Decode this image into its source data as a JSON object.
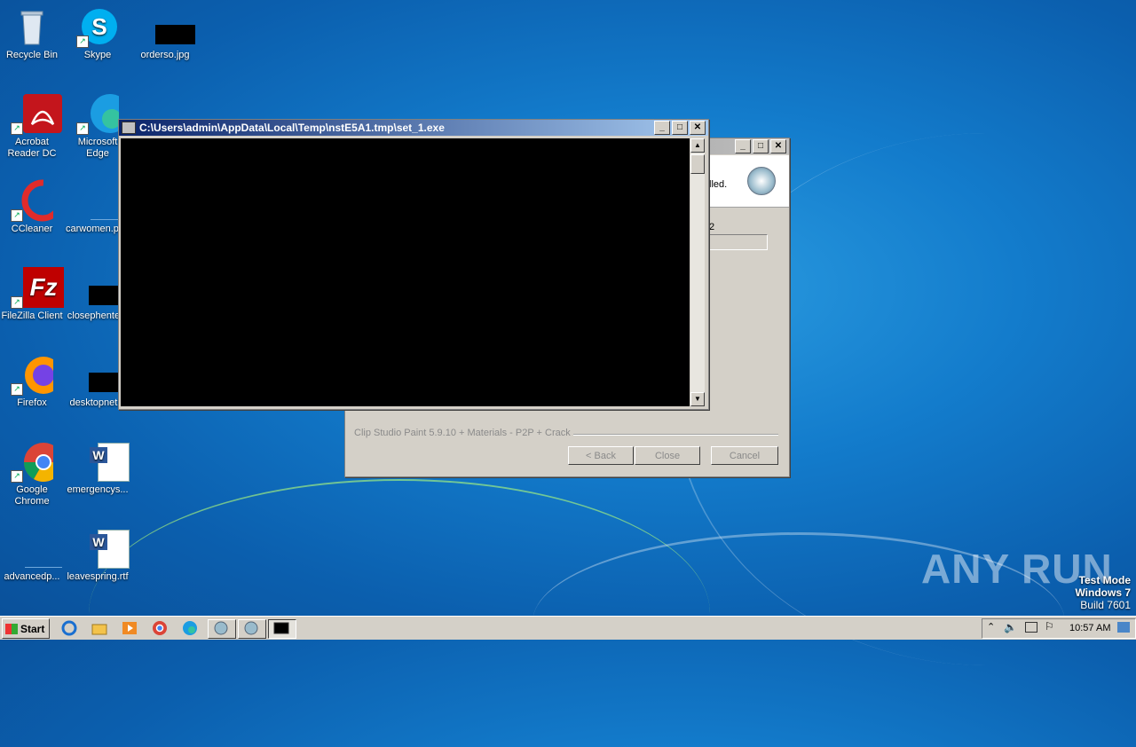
{
  "desktop": {
    "icons": [
      {
        "label": "Recycle Bin",
        "icon": "recycle-bin-icon"
      },
      {
        "label": "Skype",
        "icon": "skype-icon"
      },
      {
        "label": "orderso.jpg",
        "icon": "image-file-icon"
      },
      {
        "label": "Acrobat Reader DC",
        "icon": "acrobat-icon"
      },
      {
        "label": "Microsoft Edge",
        "icon": "edge-icon"
      },
      {
        "label": "CCleaner",
        "icon": "ccleaner-icon"
      },
      {
        "label": "carwomen.png",
        "icon": "file-icon"
      },
      {
        "label": "FileZilla Client",
        "icon": "filezilla-icon"
      },
      {
        "label": "closephente...",
        "icon": "file-icon"
      },
      {
        "label": "Firefox",
        "icon": "firefox-icon"
      },
      {
        "label": "desktopnet...",
        "icon": "file-icon"
      },
      {
        "label": "Google Chrome",
        "icon": "chrome-icon"
      },
      {
        "label": "emergencys...",
        "icon": "word-doc-icon"
      },
      {
        "label": "advancedp...",
        "icon": "file-icon"
      },
      {
        "label": "leavespring.rtf",
        "icon": "word-doc-icon"
      }
    ]
  },
  "installer": {
    "text_partial": "lled.",
    "status_partial": "2",
    "footer_brand": "Clip Studio Paint 5.9.10 + Materials - P2P + Crack",
    "back_label": "< Back",
    "close_label": "Close",
    "cancel_label": "Cancel"
  },
  "console": {
    "title": "C:\\Users\\admin\\AppData\\Local\\Temp\\nstE5A1.tmp\\set_1.exe"
  },
  "watermark": {
    "brand": "ANY RUN",
    "test_mode": "Test Mode",
    "os": "Windows 7",
    "build": "Build 7601"
  },
  "taskbar": {
    "start_label": "Start",
    "clock": "10:57 AM"
  },
  "colors": {
    "desktop": "#137ccc",
    "active_title": "#0a246a",
    "console_bg": "#000000"
  }
}
